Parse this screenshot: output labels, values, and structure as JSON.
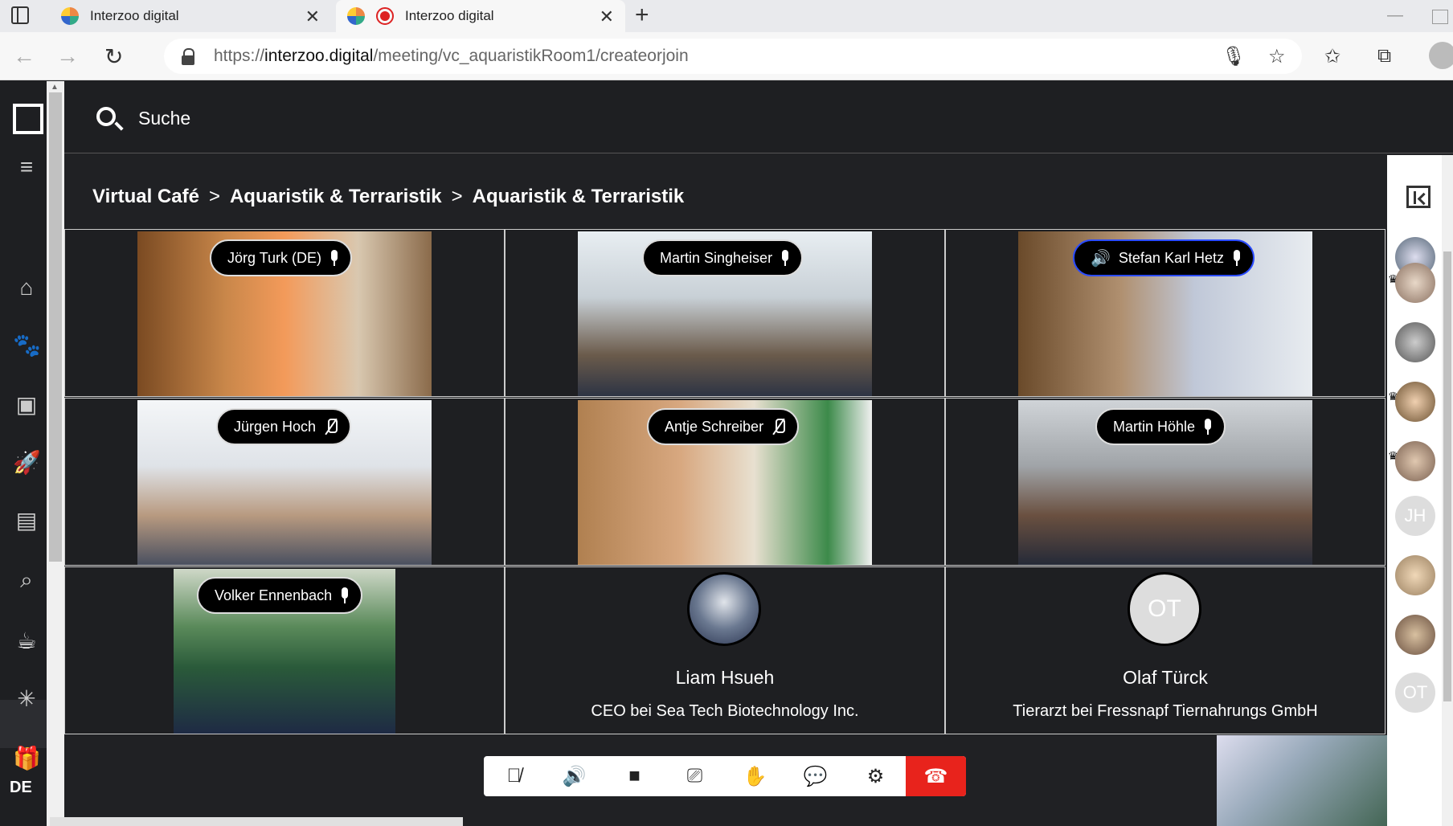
{
  "browser": {
    "tabs": [
      {
        "label": "Interzoo digital"
      },
      {
        "label": "Interzoo digital"
      }
    ],
    "url_prefix": "https://",
    "url_host": "interzoo.digital",
    "url_path": "/meeting/vc_aquaristikRoom1/createorjoin"
  },
  "app": {
    "search_label": "Suche",
    "language": "DE",
    "breadcrumb": [
      "Virtual Café",
      "Aquaristik & Terraristik",
      "Aquaristik & Terraristik"
    ],
    "breadcrumb_sep": ">"
  },
  "participants": [
    {
      "name": "Jörg Turk (DE)",
      "mic": "on"
    },
    {
      "name": "Martin Singheiser",
      "mic": "on"
    },
    {
      "name": "Stefan Karl Hetz",
      "mic": "on",
      "speaking": true
    },
    {
      "name": "Jürgen Hoch",
      "mic": "off"
    },
    {
      "name": "Antje Schreiber",
      "mic": "off"
    },
    {
      "name": "Martin Höhle",
      "mic": "on"
    },
    {
      "name": "Volker Ennenbach",
      "mic": "on"
    },
    {
      "name": "Liam Hsueh",
      "title": "CEO bei Sea Tech Biotechnology Inc."
    },
    {
      "name": "Olaf Türck",
      "title": "Tierarzt bei Fressnapf Tiernahrungs GmbH",
      "initials": "OT"
    }
  ],
  "participant_list_initials": [
    "JH",
    "OT"
  ],
  "colors": {
    "accent_active": "#2a4bff",
    "end_call": "#e8231c",
    "background": "#202124"
  },
  "controls": [
    "mic-muted-icon",
    "speaker-icon",
    "camera-icon",
    "screen-share-icon",
    "raise-hand-icon",
    "chat-icon",
    "settings-icon",
    "end-call-icon"
  ]
}
